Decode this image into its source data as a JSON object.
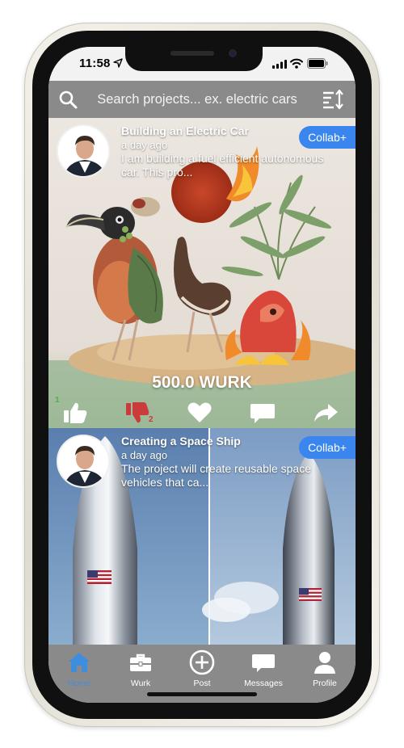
{
  "status_bar": {
    "time": "11:58"
  },
  "search": {
    "placeholder": "Search projects... ex. electric cars"
  },
  "posts": [
    {
      "title": "Building an Electric Car",
      "time": "a day ago",
      "description": "I am building a fuel efficient autonomous car. This pro...",
      "collab_label": "Collab+",
      "amount": "500.0 WURK",
      "like_count": "1",
      "dislike_count": "2"
    },
    {
      "title": "Creating a Space Ship",
      "time": "a day ago",
      "description": "The project will create reusable space vehicles that ca...",
      "collab_label": "Collab+"
    }
  ],
  "tabs": [
    {
      "label": "Home",
      "icon": "home-icon"
    },
    {
      "label": "Wurk",
      "icon": "briefcase-icon"
    },
    {
      "label": "Post",
      "icon": "add-circle-icon"
    },
    {
      "label": "Messages",
      "icon": "chat-icon"
    },
    {
      "label": "Profile",
      "icon": "person-icon"
    }
  ],
  "colors": {
    "header": "#8a8a8a",
    "accent": "#3a86ee",
    "active_tab": "#3f8ede",
    "like": "#ffffff",
    "dislike": "#cc3b3b",
    "like_count": "#4caf50"
  }
}
